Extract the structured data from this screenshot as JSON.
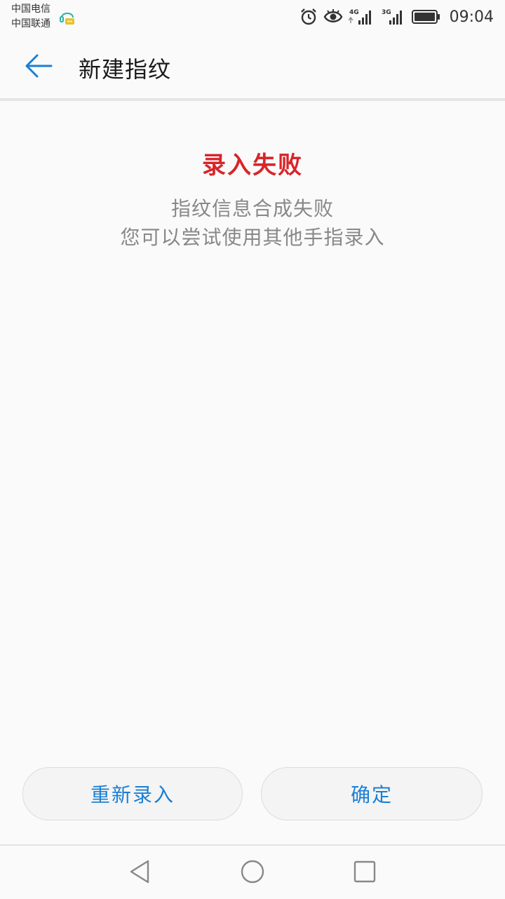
{
  "status_bar": {
    "carrier_1": "中国电信",
    "carrier_2": "中国联通",
    "network_1": "4G",
    "network_2": "3G",
    "time": "09:04"
  },
  "header": {
    "title": "新建指纹"
  },
  "result": {
    "title": "录入失败",
    "line_1": "指纹信息合成失败",
    "line_2": "您可以尝试使用其他手指录入"
  },
  "buttons": {
    "retry_label": "重新录入",
    "ok_label": "确定"
  },
  "colors": {
    "accent": "#1a7fd4",
    "error": "#d8252a",
    "secondary_text": "#888888",
    "background": "#fafafa"
  },
  "icons": {
    "back": "arrow-left-icon",
    "hd": "hd-voice-icon",
    "alarm": "alarm-icon",
    "eye": "eye-comfort-icon",
    "signal": "signal-icon",
    "battery": "battery-icon",
    "nav_back": "nav-back-icon",
    "nav_home": "nav-home-icon",
    "nav_recent": "nav-recent-icon"
  }
}
